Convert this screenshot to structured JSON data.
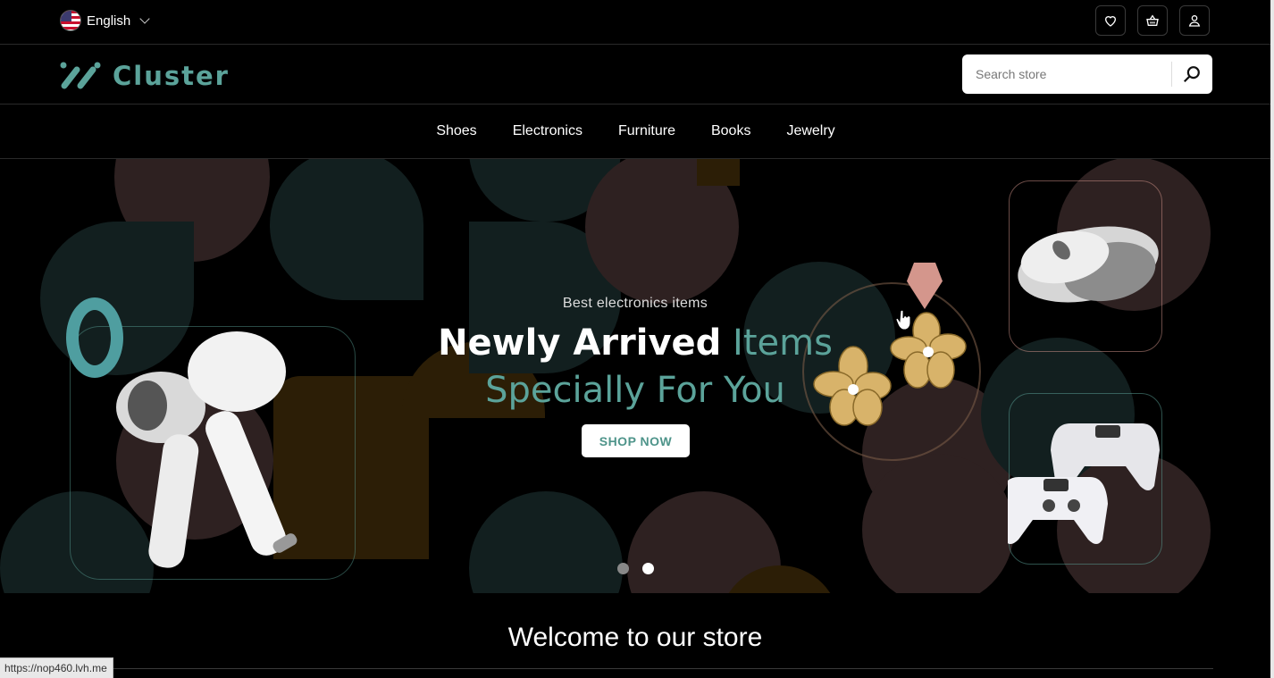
{
  "topbar": {
    "language": "English",
    "icons": [
      "heart-icon",
      "basket-icon",
      "user-icon"
    ]
  },
  "header": {
    "logo_text": "Cluster",
    "search": {
      "placeholder": "Search store"
    }
  },
  "nav": {
    "items": [
      "Shoes",
      "Electronics",
      "Furniture",
      "Books",
      "Jewelry"
    ]
  },
  "hero": {
    "subtitle": "Best electronics items",
    "title_white": "Newly Arrived",
    "title_teal_1": "Items",
    "title_teal_2": "Specially For You",
    "button": "SHOP NOW",
    "slides_count": 2,
    "active_slide": 2
  },
  "welcome": "Welcome to our store",
  "status_url": "https://nop460.lvh.me",
  "colors": {
    "accent": "#5ba39a",
    "background": "#000000"
  }
}
